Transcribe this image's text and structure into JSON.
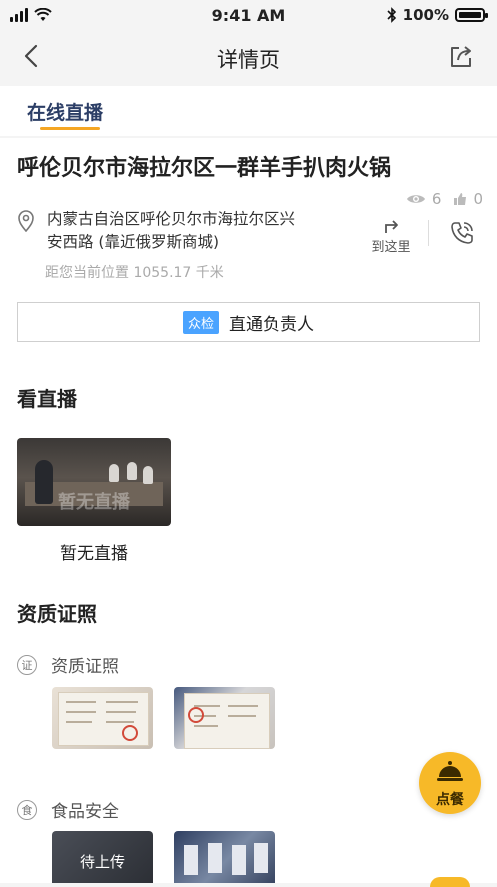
{
  "status_bar": {
    "time": "9:41 AM",
    "battery_text": "100%"
  },
  "nav": {
    "title": "详情页"
  },
  "tabs": [
    {
      "label": "在线直播"
    }
  ],
  "shop": {
    "name": "呼伦贝尔市海拉尔区一群羊手扒肉火锅",
    "views": "6",
    "likes": "0",
    "address_line1": "内蒙古自治区呼伦贝尔市海拉尔区兴",
    "address_line2": "安西路 (靠近俄罗斯商城)",
    "distance": "距您当前位置 1055.17 千米",
    "goto_label": "到这里"
  },
  "contact": {
    "badge": "众检",
    "label": "直通负责人"
  },
  "live": {
    "section_title": "看直播",
    "thumb_overlay": "暂无直播",
    "caption": "暂无直播"
  },
  "qualification": {
    "section_title": "资质证照",
    "license": {
      "icon_char": "证",
      "label": "资质证照"
    },
    "food_safety": {
      "icon_char": "食",
      "label": "食品安全",
      "pending": "待上传"
    }
  },
  "order_button": {
    "label": "点餐"
  },
  "colors": {
    "accent": "#f5a623",
    "tab_text": "#2c3e66",
    "badge_blue": "#4aa3ff",
    "fab": "#f7b928"
  }
}
